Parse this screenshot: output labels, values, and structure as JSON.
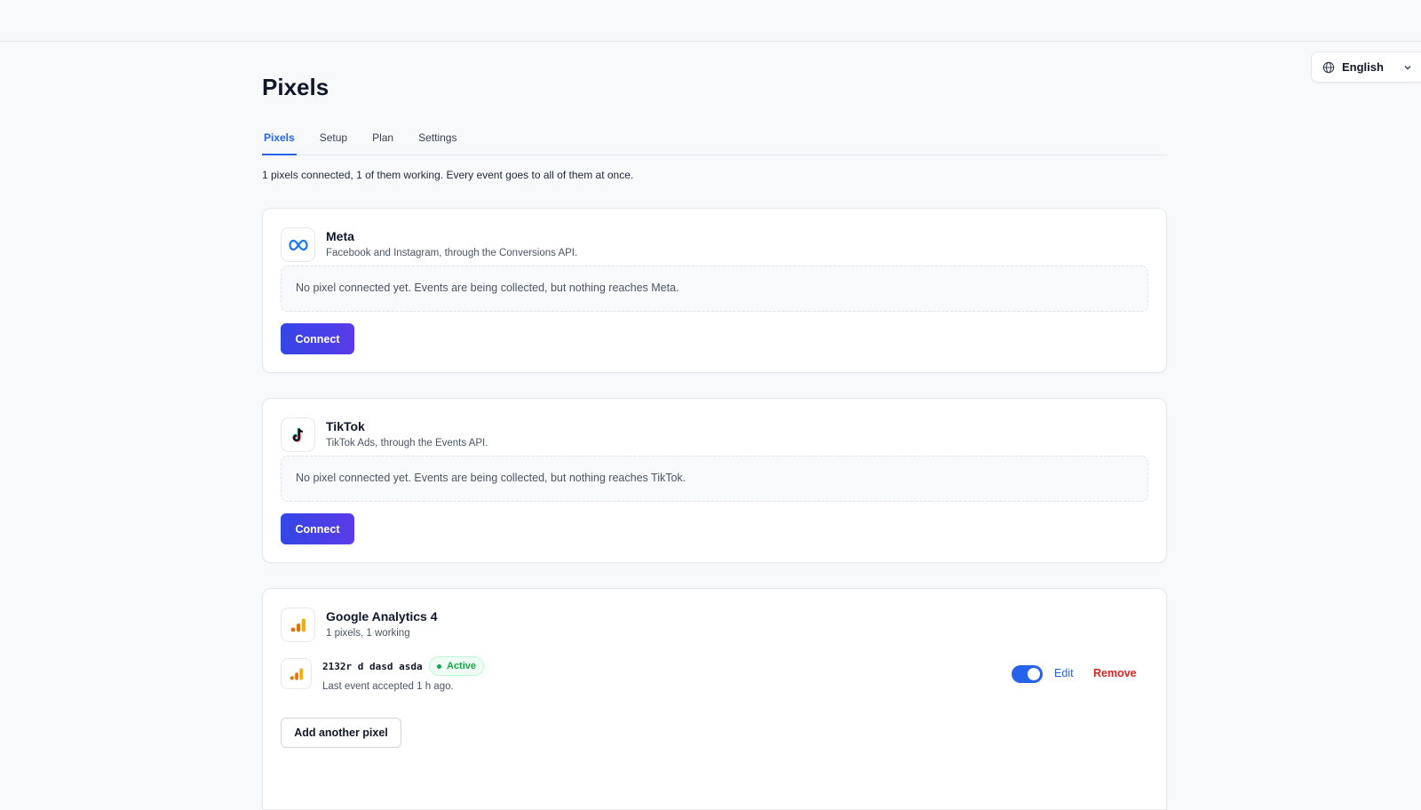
{
  "language": {
    "label": "English",
    "icon": "globe-icon"
  },
  "page": {
    "title": "Pixels"
  },
  "tabs": [
    {
      "label": "Pixels",
      "active": true
    },
    {
      "label": "Setup",
      "active": false
    },
    {
      "label": "Plan",
      "active": false
    },
    {
      "label": "Settings",
      "active": false
    }
  ],
  "summary": "1 pixels connected, 1 of them working. Every event goes to all of them at once.",
  "cards": {
    "meta": {
      "title": "Meta",
      "subtitle": "Facebook and Instagram, through the Conversions API.",
      "empty": "No pixel connected yet. Events are being collected, but nothing reaches Meta.",
      "button": "Connect",
      "icon": "meta-infinity-icon"
    },
    "tiktok": {
      "title": "TikTok",
      "subtitle": "TikTok Ads, through the Events API.",
      "empty": "No pixel connected yet. Events are being collected, but nothing reaches TikTok.",
      "button": "Connect",
      "icon": "tiktok-note-icon"
    },
    "ga4": {
      "title": "Google Analytics 4",
      "subtitle": "1 pixels, 1 working",
      "icon": "analytics-bars-icon",
      "pixel": {
        "name": "2132r d dasd asda",
        "status": "Active",
        "meta": "Last event accepted 1 h ago.",
        "enabled": true,
        "edit": "Edit",
        "remove": "Remove"
      },
      "add_button": "Add another pixel"
    }
  },
  "colors": {
    "accent": "#2563eb",
    "primary_gradient_start": "#3346e6",
    "primary_gradient_end": "#5b3be8",
    "success": "#16a34a",
    "danger": "#dc2626",
    "ga_orange": "#f9ab00",
    "ga_dark_orange": "#e37400"
  }
}
